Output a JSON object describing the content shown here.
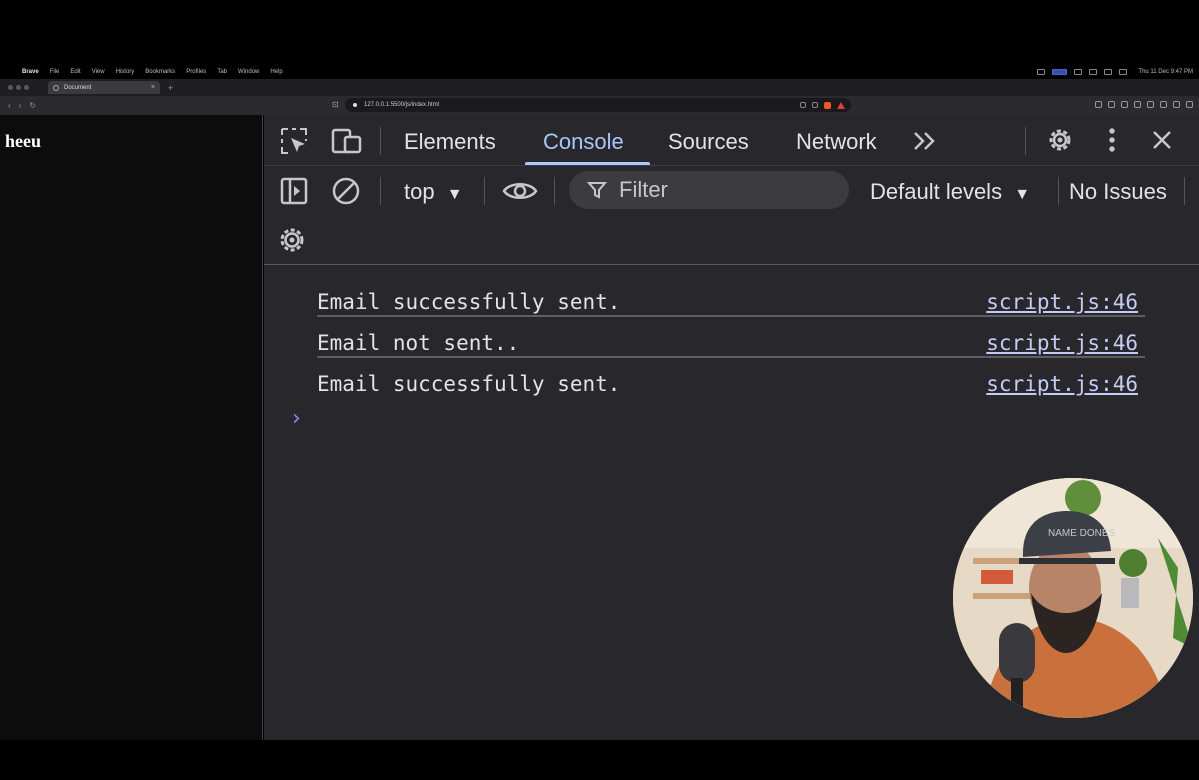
{
  "menubar": {
    "items": [
      "Brave",
      "File",
      "Edit",
      "View",
      "History",
      "Bookmarks",
      "Profiles",
      "Tab",
      "Window",
      "Help"
    ],
    "clock": "Thu 11 Dec 9:47 PM"
  },
  "browser": {
    "tab_title": "Document",
    "url": "127.0.0.1:5500/js/index.html"
  },
  "page": {
    "text": "heeu"
  },
  "devtools": {
    "tabs": [
      "Elements",
      "Console",
      "Sources",
      "Network"
    ],
    "active_tab": "Console",
    "context": "top",
    "filter_placeholder": "Filter",
    "levels": "Default levels",
    "issues": "No Issues",
    "accent_color": "#a8c7fa"
  },
  "console": {
    "messages": [
      {
        "text": "Email successfully sent.",
        "source": "script.js:46"
      },
      {
        "text": "Email not sent..",
        "source": "script.js:46"
      },
      {
        "text": "Email successfully sent.",
        "source": "script.js:46"
      }
    ]
  },
  "overlay": {
    "cap_text": "NAME DONES"
  }
}
